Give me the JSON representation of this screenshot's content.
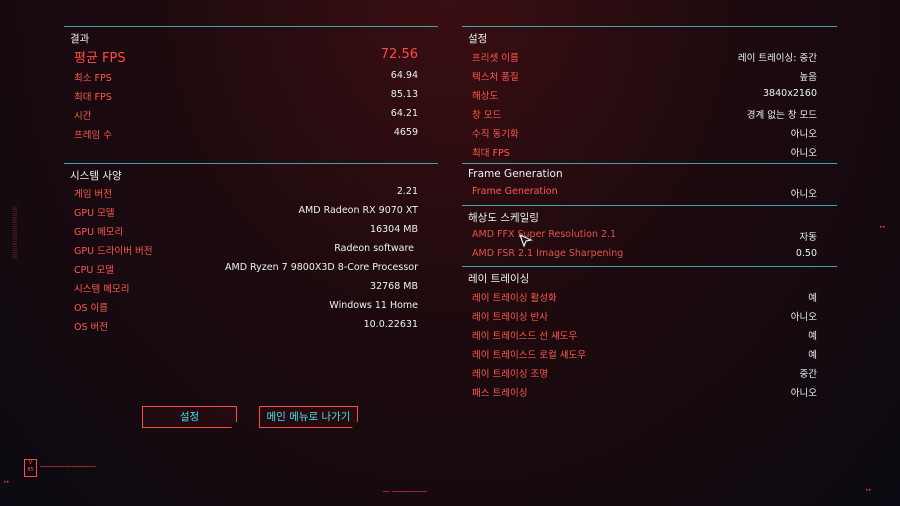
{
  "results": {
    "header": "결과",
    "avg_fps": {
      "label": "평균 FPS",
      "value": "72.56"
    },
    "rows": [
      {
        "label": "최소 FPS",
        "value": "64.94"
      },
      {
        "label": "최대 FPS",
        "value": "85.13"
      },
      {
        "label": "시간",
        "value": "64.21"
      },
      {
        "label": "프레임 수",
        "value": "4659"
      }
    ]
  },
  "system": {
    "header": "시스템 사양",
    "rows": [
      {
        "label": "게임 버전",
        "value": "2.21"
      },
      {
        "label": "GPU 모델",
        "value": "AMD Radeon RX 9070 XT"
      },
      {
        "label": "GPU 메모리",
        "value": "16304 MB"
      },
      {
        "label": "GPU 드라이버 버전",
        "value": "Radeon software"
      },
      {
        "label": "CPU 모델",
        "value": "AMD Ryzen 7 9800X3D 8-Core Processor"
      },
      {
        "label": "시스템 메모리",
        "value": "32768 MB"
      },
      {
        "label": "OS 이름",
        "value": "Windows 11 Home"
      },
      {
        "label": "OS 버전",
        "value": "10.0.22631"
      }
    ]
  },
  "settings": {
    "header": "설정",
    "rows": [
      {
        "label": "프리셋 이름",
        "value": "레이 트레이싱: 중간"
      },
      {
        "label": "텍스처 품질",
        "value": "높음"
      },
      {
        "label": "해상도",
        "value": "3840x2160"
      },
      {
        "label": "창 모드",
        "value": "경계 없는 창 모드"
      },
      {
        "label": "수직 동기화",
        "value": "아니오"
      },
      {
        "label": "최대 FPS",
        "value": "아니오"
      }
    ]
  },
  "frame_gen": {
    "header": "Frame Generation",
    "rows": [
      {
        "label": "Frame Generation",
        "value": "아니오"
      }
    ]
  },
  "upscaling": {
    "header": "해상도 스케일링",
    "rows": [
      {
        "label": "AMD FFX Super Resolution 2.1",
        "value": "자동"
      },
      {
        "label": "AMD FSR 2.1 Image Sharpening",
        "value": "0.50"
      }
    ]
  },
  "raytracing": {
    "header": "레이 트레이싱",
    "rows": [
      {
        "label": "레이 트레이싱 활성화",
        "value": "예"
      },
      {
        "label": "레이 트레이싱 반사",
        "value": "아니오"
      },
      {
        "label": "레이 트레이스드 선 섀도우",
        "value": "예"
      },
      {
        "label": "레이 트레이스드 로컬 섀도우",
        "value": "예"
      },
      {
        "label": "레이 트레이싱 조명",
        "value": "중간"
      },
      {
        "label": "패스 트레이싱",
        "value": "아니오"
      }
    ]
  },
  "buttons": {
    "settings": "설정",
    "main_menu": "메인 메뉴로 나가기"
  },
  "colors": {
    "accent_red": "#ff4a42",
    "accent_cyan": "#4fd0d8",
    "divider": "#3aa7ad"
  }
}
